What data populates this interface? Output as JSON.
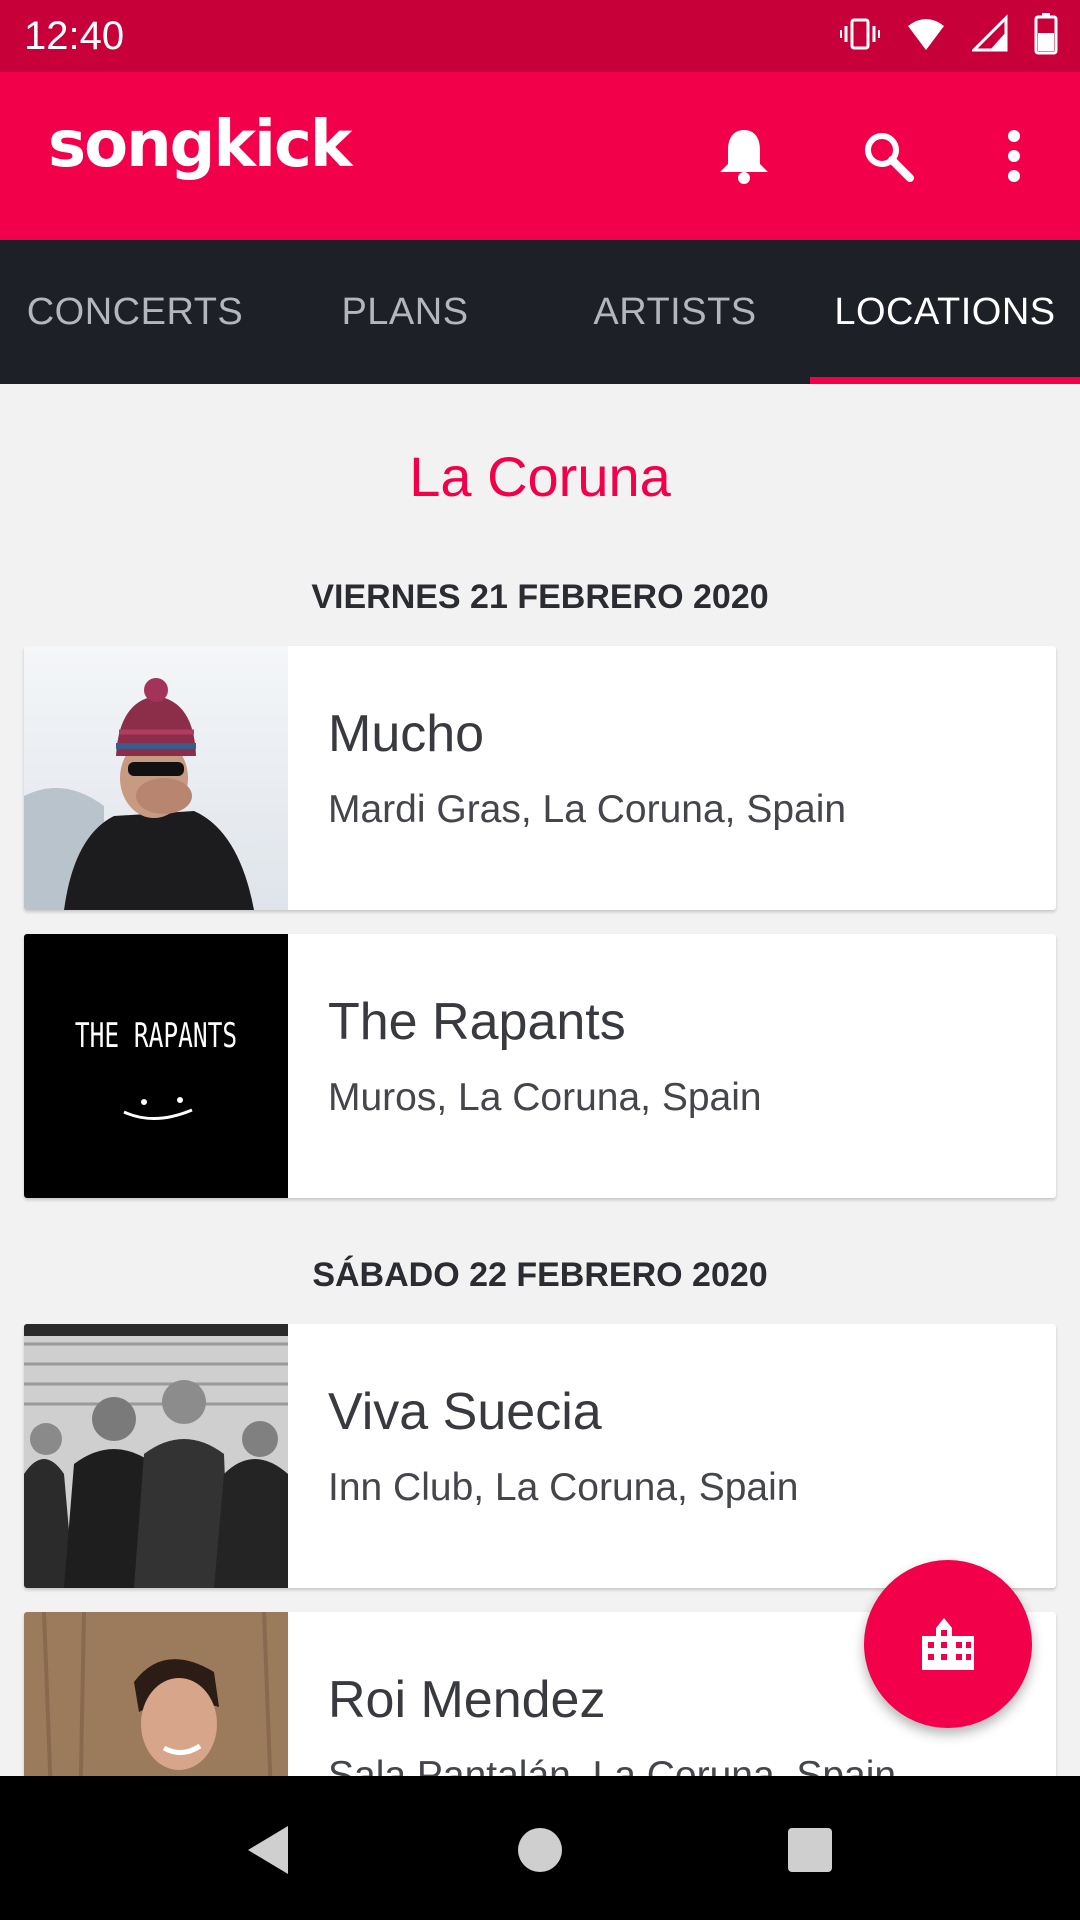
{
  "status_bar": {
    "time": "12:40",
    "icons": [
      "vibrate-icon",
      "wifi-icon",
      "signal-icon",
      "battery-icon"
    ]
  },
  "app_bar": {
    "logo": "songkick",
    "actions": [
      "bell-icon",
      "search-icon",
      "more-vert-icon"
    ]
  },
  "tabs": [
    {
      "label": "CONCERTS",
      "active": false
    },
    {
      "label": "PLANS",
      "active": false
    },
    {
      "label": "ARTISTS",
      "active": false
    },
    {
      "label": "LOCATIONS",
      "active": true
    }
  ],
  "city": "La Coruna",
  "groups": [
    {
      "date": "VIERNES 21 FEBRERO 2020",
      "events": [
        {
          "artist": "Mucho",
          "venue": "Mardi Gras, La Coruna, Spain"
        },
        {
          "artist": "The Rapants",
          "venue": "Muros, La Coruna, Spain",
          "image_text": "THE RAPANTS"
        }
      ]
    },
    {
      "date": "SÁBADO 22 FEBRERO 2020",
      "events": [
        {
          "artist": "Viva Suecia",
          "venue": "Inn Club, La Coruna, Spain"
        },
        {
          "artist": "Roi Mendez",
          "venue": "Sala Pantalán, La Coruna, Spain"
        }
      ]
    }
  ],
  "fab": {
    "icon": "city-icon"
  },
  "colors": {
    "brand": "#f2004a",
    "status_bar": "#c8003a",
    "tab_bar": "#1d2026"
  }
}
